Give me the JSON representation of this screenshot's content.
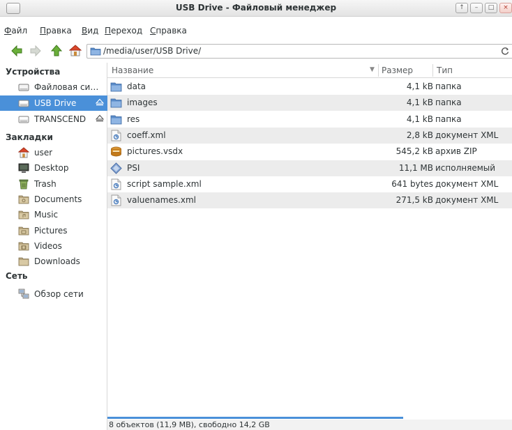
{
  "window": {
    "title": "USB Drive - Файловый менеджер",
    "buttons": {
      "sticky": "↑",
      "minimize": "–",
      "maximize": "□",
      "close": "×"
    }
  },
  "menu": {
    "file": {
      "first": "Ф",
      "rest": "айл"
    },
    "edit": {
      "first": "П",
      "rest": "равка"
    },
    "view": {
      "first": "В",
      "rest": "ид"
    },
    "go": {
      "first": "П",
      "rest": "ереход"
    },
    "help": {
      "first": "С",
      "rest": "правка"
    }
  },
  "toolbar": {
    "icons": [
      "back-arrow-icon",
      "forward-arrow-icon",
      "up-arrow-icon",
      "home-icon"
    ],
    "path": "/media/user/USB Drive/"
  },
  "sidebar": {
    "devices_title": "Устройства",
    "devices": [
      {
        "label": "Файловая система",
        "icon": "drive-icon",
        "selected": false,
        "eject": false
      },
      {
        "label": "USB Drive",
        "icon": "usb-drive-icon",
        "selected": true,
        "eject": true
      },
      {
        "label": "TRANSCEND",
        "icon": "usb-drive-icon",
        "selected": false,
        "eject": true
      }
    ],
    "bookmarks_title": "Закладки",
    "bookmarks": [
      {
        "label": "user",
        "icon": "home-icon"
      },
      {
        "label": "Desktop",
        "icon": "desktop-icon"
      },
      {
        "label": "Trash",
        "icon": "trash-icon"
      },
      {
        "label": "Documents",
        "icon": "documents-folder-icon"
      },
      {
        "label": "Music",
        "icon": "music-folder-icon"
      },
      {
        "label": "Pictures",
        "icon": "pictures-folder-icon"
      },
      {
        "label": "Videos",
        "icon": "videos-folder-icon"
      },
      {
        "label": "Downloads",
        "icon": "downloads-folder-icon"
      }
    ],
    "network_title": "Сеть",
    "network": [
      {
        "label": "Обзор сети",
        "icon": "network-icon"
      }
    ]
  },
  "filelist": {
    "columns": {
      "name": "Название",
      "size": "Размер",
      "type": "Тип"
    },
    "rows": [
      {
        "name": "data",
        "size": "4,1 kB",
        "type": "папка",
        "icon": "folder-icon"
      },
      {
        "name": "images",
        "size": "4,1 kB",
        "type": "папка",
        "icon": "folder-icon"
      },
      {
        "name": "res",
        "size": "4,1 kB",
        "type": "папка",
        "icon": "folder-icon"
      },
      {
        "name": "coeff.xml",
        "size": "2,8 kB",
        "type": "документ XML",
        "icon": "xml-file-icon"
      },
      {
        "name": "pictures.vsdx",
        "size": "545,2 kB",
        "type": "архив ZIP",
        "icon": "archive-icon"
      },
      {
        "name": "PSI",
        "size": "11,1 MB",
        "type": "исполняемый",
        "icon": "executable-icon"
      },
      {
        "name": "script sample.xml",
        "size": "641 bytes",
        "type": "документ XML",
        "icon": "xml-file-icon"
      },
      {
        "name": "valuenames.xml",
        "size": "271,5 kB",
        "type": "документ XML",
        "icon": "xml-file-icon"
      }
    ]
  },
  "status": {
    "text": "8 объектов (11,9 MB), свободно 14,2 GB"
  },
  "colors": {
    "selection": "#4a90d9",
    "folder": "#5a8bc8",
    "alt_row": "#ececec"
  }
}
